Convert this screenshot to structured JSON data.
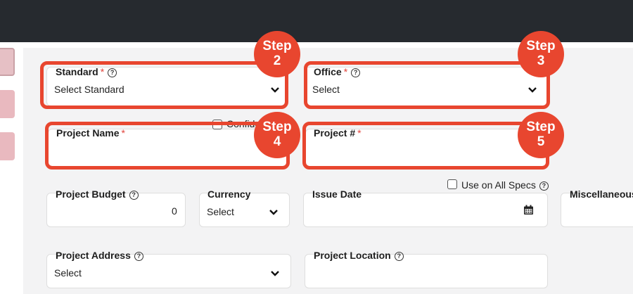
{
  "colors": {
    "accent": "#e8462f",
    "topbar": "#262a2f",
    "required": "#e0443c"
  },
  "steps": {
    "s2": {
      "word": "Step",
      "num": "2"
    },
    "s3": {
      "word": "Step",
      "num": "3"
    },
    "s4": {
      "word": "Step",
      "num": "4"
    },
    "s5": {
      "word": "Step",
      "num": "5"
    }
  },
  "form": {
    "standard": {
      "label": "Standard",
      "required": "*",
      "value": "Select Standard"
    },
    "office": {
      "label": "Office",
      "required": "*",
      "value": "Select"
    },
    "project_name": {
      "label": "Project Name",
      "required": "*",
      "value": ""
    },
    "confidential": {
      "label": "Confide"
    },
    "project_number": {
      "label": "Project #",
      "required": "*",
      "value": ""
    },
    "project_budget": {
      "label": "Project Budget",
      "value": "0"
    },
    "currency": {
      "label": "Currency",
      "value": "Select"
    },
    "use_on_all_specs": {
      "label": "Use on All Specs"
    },
    "issue_date": {
      "label": "Issue Date",
      "value": ""
    },
    "miscellaneous": {
      "label": "Miscellaneous"
    },
    "project_address": {
      "label": "Project Address",
      "value": "Select"
    },
    "project_location": {
      "label": "Project Location",
      "value": ""
    }
  },
  "icons": {
    "help": "?",
    "chevron": "chevron-down-icon",
    "calendar": "calendar-icon"
  }
}
